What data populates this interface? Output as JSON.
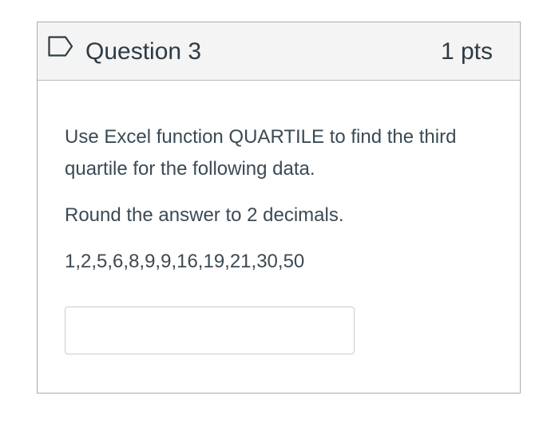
{
  "question": {
    "title": "Question 3",
    "points": "1 pts",
    "flag_icon": "flag-outline-icon",
    "prompt": "Use Excel function QUARTILE to find the third quartile for the following data.",
    "instruction": "Round the answer to 2 decimals.",
    "data_values": "1,2,5,6,8,9,9,16,19,21,30,50",
    "answer_value": "",
    "answer_placeholder": ""
  },
  "colors": {
    "header_bg": "#f4f4f4",
    "border": "#a8adb1",
    "text": "#2d3b45",
    "flag_stroke": "#2d3b45"
  }
}
